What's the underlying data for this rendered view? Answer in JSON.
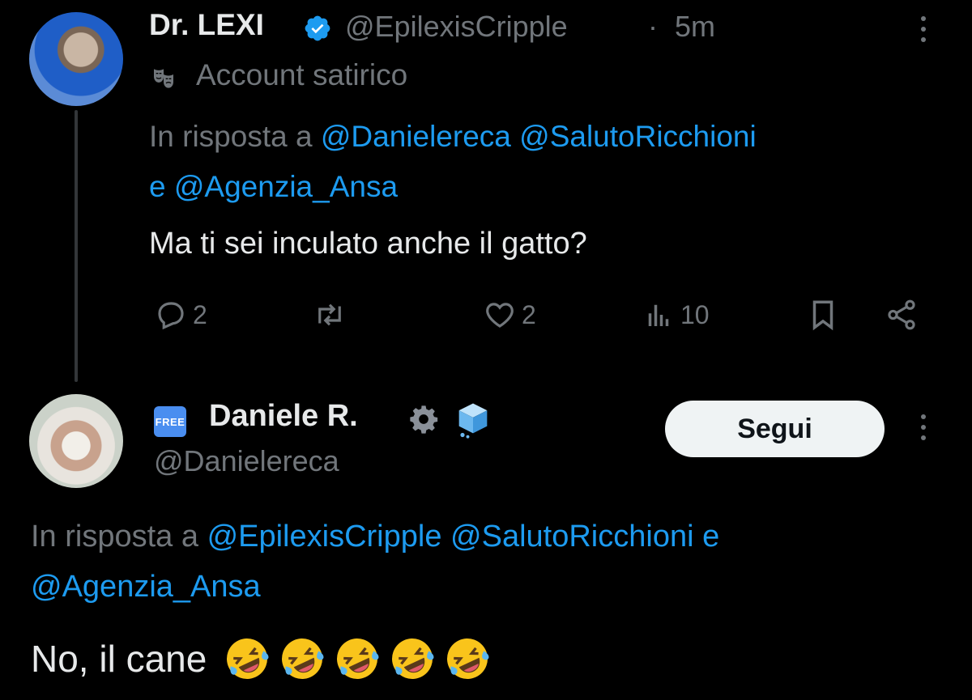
{
  "tweet1": {
    "display_name": "Dr. LEXI",
    "handle": "@EpilexisCripple",
    "separator": "·",
    "time": "5m",
    "label_text": "Account satirico",
    "reply_prefix": "In risposta a",
    "reply_mentions_line1": [
      "@Danielereca",
      "@SalutoRicchioni"
    ],
    "reply_conj": "e",
    "reply_mentions_line2": [
      "@Agenzia_Ansa"
    ],
    "text": "Ma ti sei inculato anche il gatto?",
    "actions": {
      "replies": "2",
      "likes": "2",
      "views": "10"
    }
  },
  "tweet2": {
    "badge_text": "FREE",
    "display_name": "Daniele R.",
    "handle": "@Danielereca",
    "follow_label": "Segui",
    "reply_prefix": "In risposta a",
    "reply_mentions_line1": [
      "@EpilexisCripple",
      "@SalutoRicchioni"
    ],
    "reply_conj": "e",
    "reply_mentions_line2": [
      "@Agenzia_Ansa"
    ],
    "text": "No, il cane",
    "emoji_count": 5,
    "emoji_name": "rolling-on-floor-laughing"
  },
  "colors": {
    "background": "#000000",
    "text_primary": "#e7e9ea",
    "text_secondary": "#71767b",
    "mention_blue": "#1d9bf0",
    "verified_blue": "#1d9bf0",
    "follow_button_bg": "#eff3f4"
  }
}
